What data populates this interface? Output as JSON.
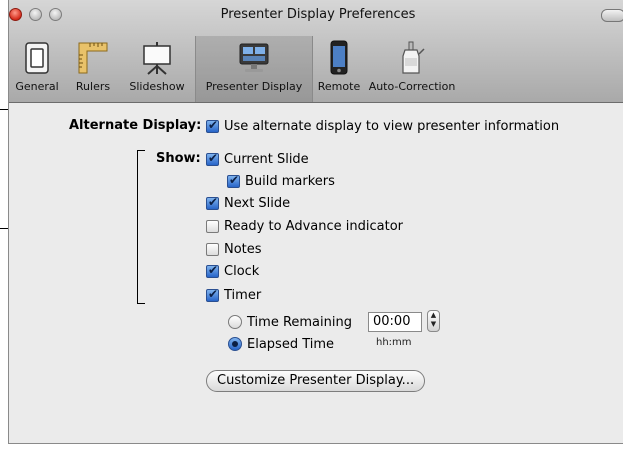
{
  "window": {
    "title": "Presenter Display Preferences"
  },
  "toolbar": {
    "items": [
      {
        "label": "General",
        "icon": "general-switch-icon"
      },
      {
        "label": "Rulers",
        "icon": "ruler-icon"
      },
      {
        "label": "Slideshow",
        "icon": "slideshow-screen-icon"
      },
      {
        "label": "Presenter Display",
        "icon": "presenter-display-icon",
        "selected": true
      },
      {
        "label": "Remote",
        "icon": "iphone-remote-icon"
      },
      {
        "label": "Auto-Correction",
        "icon": "auto-correction-icon"
      }
    ]
  },
  "alternate_display": {
    "label": "Alternate Display:",
    "option_label": "Use alternate display to view presenter information",
    "checked": true
  },
  "show": {
    "label": "Show:",
    "current_slide": {
      "label": "Current Slide",
      "checked": true
    },
    "build_markers": {
      "label": "Build markers",
      "checked": true
    },
    "next_slide": {
      "label": "Next Slide",
      "checked": true
    },
    "ready_to_advance": {
      "label": "Ready to Advance indicator",
      "checked": false
    },
    "notes": {
      "label": "Notes",
      "checked": false
    },
    "clock": {
      "label": "Clock",
      "checked": true
    },
    "timer": {
      "label": "Timer",
      "checked": true
    }
  },
  "timer_mode": {
    "time_remaining": {
      "label": "Time Remaining",
      "selected": false
    },
    "elapsed_time": {
      "label": "Elapsed Time",
      "selected": true
    },
    "time_value": "00:00",
    "format_hint": "hh:mm"
  },
  "customize_button": {
    "label": "Customize Presenter Display..."
  },
  "colors": {
    "checkbox_accent": "#2764c8",
    "callout_line": "#000000"
  }
}
